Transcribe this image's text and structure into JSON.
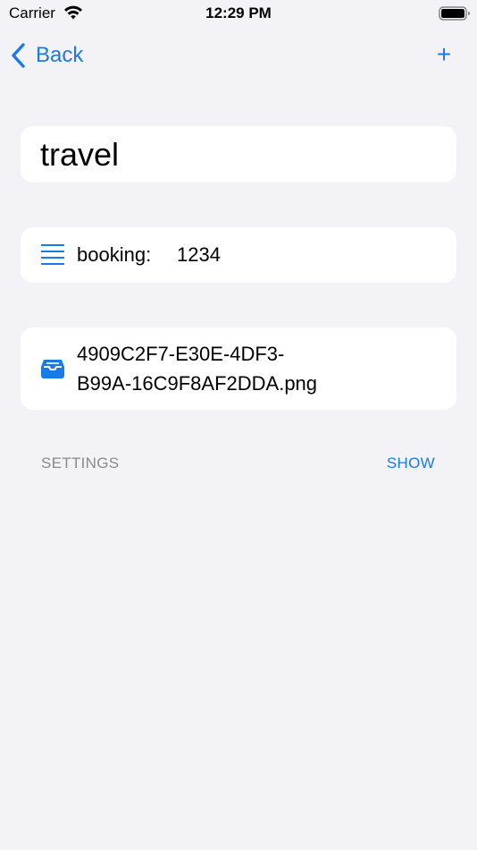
{
  "status_bar": {
    "carrier": "Carrier",
    "time": "12:29 PM",
    "wifi_icon": "wifi-icon",
    "battery_icon": "battery-icon"
  },
  "nav": {
    "back_label": "Back",
    "back_icon": "chevron-left-icon",
    "add_label": "+"
  },
  "title_field": {
    "value": "travel"
  },
  "note": {
    "icon": "list-icon",
    "label": "booking:",
    "value": "1234"
  },
  "attachment": {
    "icon": "tray-icon",
    "file_name": "4909C2F7-E30E-4DF3-\nB99A-16C9F8AF2DDA.png"
  },
  "settings": {
    "label": "SETTINGS",
    "show_label": "SHOW"
  },
  "colors": {
    "accent": "#1a7ae6",
    "background": "#f2f2f7",
    "card": "#ffffff",
    "secondary_text": "#8a8a8e"
  }
}
